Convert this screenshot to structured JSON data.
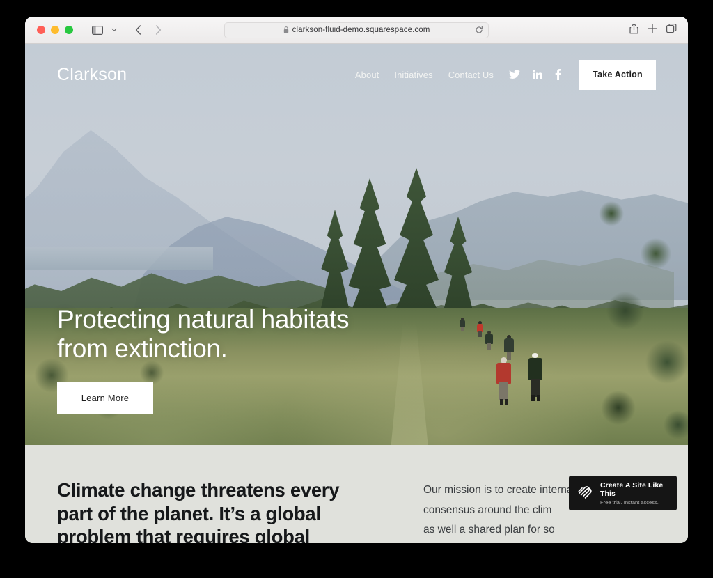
{
  "browser": {
    "url": "clarkson-fluid-demo.squarespace.com",
    "icons": {
      "lock": "lock-icon",
      "reload": "reload-icon",
      "sidebar": "sidebar-toggle-icon",
      "chevron_down": "chevron-down-icon",
      "back": "back-arrow-icon",
      "forward": "forward-arrow-icon",
      "share": "share-icon",
      "new_tab": "plus-icon",
      "tab_overview": "tab-overview-icon"
    },
    "traffic_lights": {
      "close": "#ff5f57",
      "minimize": "#febc2e",
      "maximize": "#28c840"
    }
  },
  "site": {
    "logo": "Clarkson",
    "nav": [
      {
        "label": "About"
      },
      {
        "label": "Initiatives"
      },
      {
        "label": "Contact Us"
      }
    ],
    "social": [
      {
        "name": "twitter-icon"
      },
      {
        "name": "linkedin-icon"
      },
      {
        "name": "facebook-icon"
      }
    ],
    "cta": "Take Action"
  },
  "hero": {
    "headline": "Protecting natural habitats\nfrom extinction.",
    "button": "Learn More"
  },
  "content": {
    "heading": "Climate change threatens every\npart of the planet. It’s a global\nproblem that requires global",
    "body": "Our mission is to create international\nconsensus around the clim\nas well a shared plan for so"
  },
  "banner": {
    "title": "Create A Site Like This",
    "subtitle": "Free trial. Instant access.",
    "logo": "squarespace-logo-icon"
  },
  "colors": {
    "section_bg": "#e0e1dc",
    "banner_bg": "#151515",
    "cta_bg": "#ffffff",
    "text_dark": "#16181a"
  }
}
